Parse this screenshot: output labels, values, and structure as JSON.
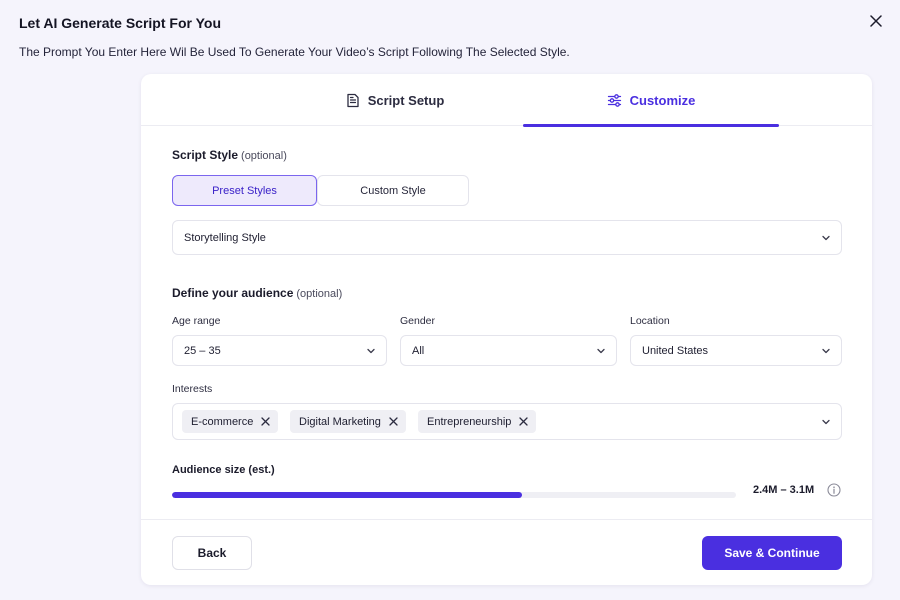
{
  "header": {
    "title": "Let AI Generate Script For You",
    "subtitle": "The Prompt You Enter Here Wil Be Used To Generate Your Video’s Script Following The Selected Style."
  },
  "tabs": [
    {
      "label": "Script Setup",
      "icon": "document-icon",
      "active": false
    },
    {
      "label": "Customize",
      "icon": "sliders-icon",
      "active": true
    }
  ],
  "script_style": {
    "label": "Script Style",
    "optional": "(optional)",
    "segments": [
      "Preset Styles",
      "Custom Style"
    ],
    "selected_segment": "Preset Styles",
    "value": "Storytelling Style"
  },
  "audience": {
    "label": "Define your audience",
    "optional": "(optional)",
    "age_range": {
      "label": "Age range",
      "value": "25 – 35"
    },
    "gender": {
      "label": "Gender",
      "value": "All"
    },
    "location": {
      "label": "Location",
      "value": "United States"
    },
    "interests": {
      "label": "Interests",
      "tags": [
        "E-commerce",
        "Digital Marketing",
        "Entrepreneurship"
      ]
    },
    "size": {
      "label": "Audience size (est.)",
      "value": "2.4M – 3.1M",
      "fill_fraction": 0.62
    }
  },
  "footer": {
    "back_label": "Back",
    "save_label": "Save & Continue"
  },
  "colors": {
    "accent": "#4a2fe0",
    "background": "#f5f4fc"
  }
}
